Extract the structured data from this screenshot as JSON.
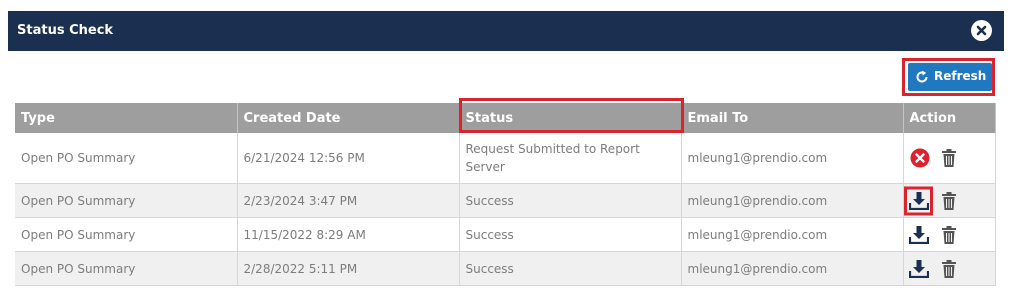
{
  "dialog": {
    "title": "Status Check"
  },
  "toolbar": {
    "refresh_label": "Refresh"
  },
  "table": {
    "headers": [
      "Type",
      "Created Date",
      "Status",
      "Email To",
      "Action"
    ],
    "rows": [
      {
        "type": "Open PO Summary",
        "created": "6/21/2024 12:56 PM",
        "status": "Request Submitted to Report Server",
        "email": "mleung1@prendio.com"
      },
      {
        "type": "Open PO Summary",
        "created": "2/23/2024 3:47 PM",
        "status": "Success",
        "email": "mleung1@prendio.com"
      },
      {
        "type": "Open PO Summary",
        "created": "11/15/2022 8:29 AM",
        "status": "Success",
        "email": "mleung1@prendio.com"
      },
      {
        "type": "Open PO Summary",
        "created": "2/28/2022 5:11 PM",
        "status": "Success",
        "email": "mleung1@prendio.com"
      }
    ]
  },
  "colors": {
    "titlebar": "#1b3050",
    "refresh": "#1f78c0",
    "highlight": "#d9232e",
    "header": "#9e9e9e",
    "cancel": "#e0202f"
  },
  "icons": [
    "close-icon",
    "refresh-icon",
    "cancel-icon",
    "download-icon",
    "trash-icon"
  ]
}
